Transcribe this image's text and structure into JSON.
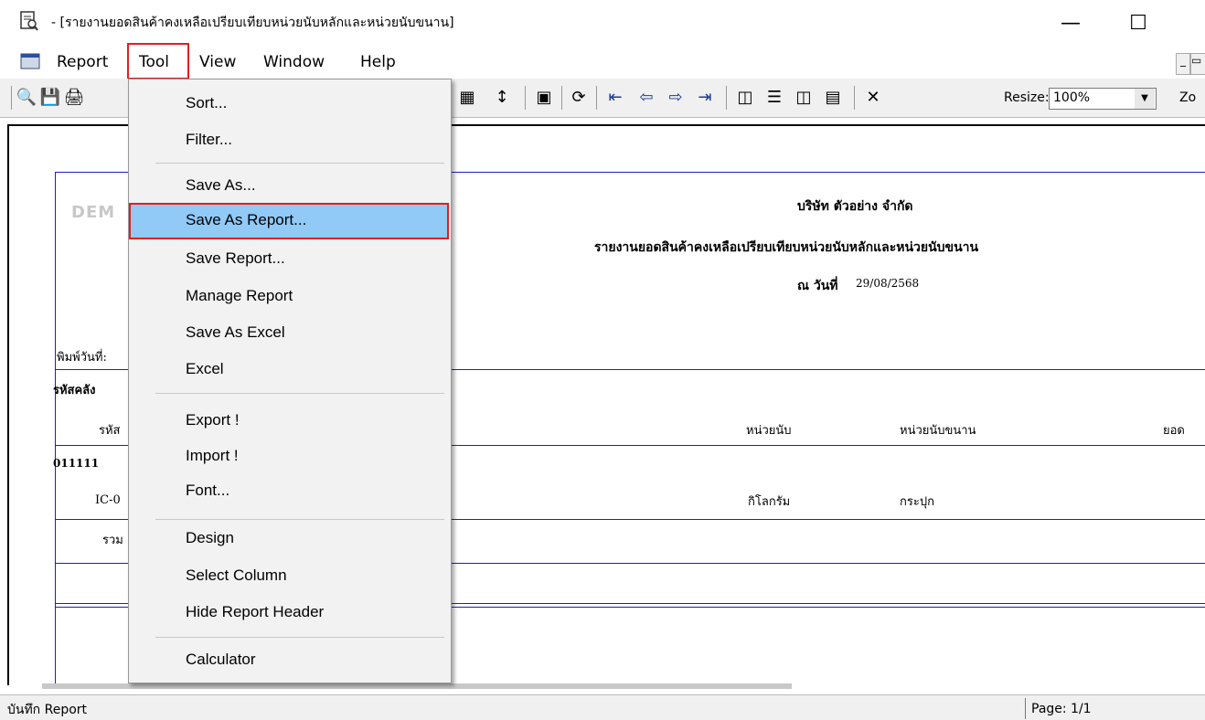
{
  "window": {
    "title": "- [รายงานยอดสินค้าคงเหลือเปรียบเทียบหน่วยนับหลักและหน่วยนับขนาน]",
    "minimize_glyph": "—",
    "maximize_glyph": "☐"
  },
  "menubar": {
    "items": [
      {
        "label": "Report"
      },
      {
        "label": "Tool"
      },
      {
        "label": "View"
      },
      {
        "label": "Window"
      },
      {
        "label": "Help"
      }
    ]
  },
  "toolbar": {
    "resize_label": "Resize:",
    "resize_value": "100%",
    "zoom_label": "Zo",
    "icons": [
      "preview-icon",
      "print-setup-icon",
      "print-icon",
      "grid-icon",
      "fit-height-icon",
      "calculator-icon",
      "refresh-icon",
      "first-page-icon",
      "previous-page-icon",
      "next-page-icon",
      "last-page-icon",
      "tile-icon",
      "rows-icon",
      "columns-icon",
      "window-icon",
      "close-icon"
    ]
  },
  "tool_menu": {
    "items": [
      {
        "label": "Sort..."
      },
      {
        "label": "Filter..."
      },
      {
        "label": "Save As..."
      },
      {
        "label": "Save As Report..."
      },
      {
        "label": "Save Report..."
      },
      {
        "label": "Manage Report"
      },
      {
        "label": "Save As Excel"
      },
      {
        "label": "Excel"
      },
      {
        "label": "Export !"
      },
      {
        "label": "Import !"
      },
      {
        "label": "Font..."
      },
      {
        "label": "Design"
      },
      {
        "label": "Select Column"
      },
      {
        "label": "Hide Report Header"
      },
      {
        "label": "Calculator"
      }
    ],
    "highlighted": "Save As Report..."
  },
  "report": {
    "watermark": "DEM",
    "company": "บริษัท ตัวอย่าง จำกัด",
    "title": "รายงานยอดสินค้าคงเหลือเปรียบเทียบหน่วยนับหลักและหน่วยนับขนาน",
    "date_label": "ณ วันที่",
    "date_value": "29/08/2568",
    "print_date_label": "พิมพ์วันที่:",
    "group_header": "รหัสคลัง",
    "col_code": "รหัส",
    "col_unit": "หน่วยนับ",
    "col_parallel_unit": "หน่วยนับขนาน",
    "col_balance": "ยอด",
    "warehouse_code": "011111",
    "item_code": "IC-0",
    "item_unit": "กิโลกรัม",
    "item_parallel_unit": "กระปุก",
    "total_label": "รวม"
  },
  "statusbar": {
    "left": "บันทึก Report",
    "page": "Page: 1/1"
  }
}
